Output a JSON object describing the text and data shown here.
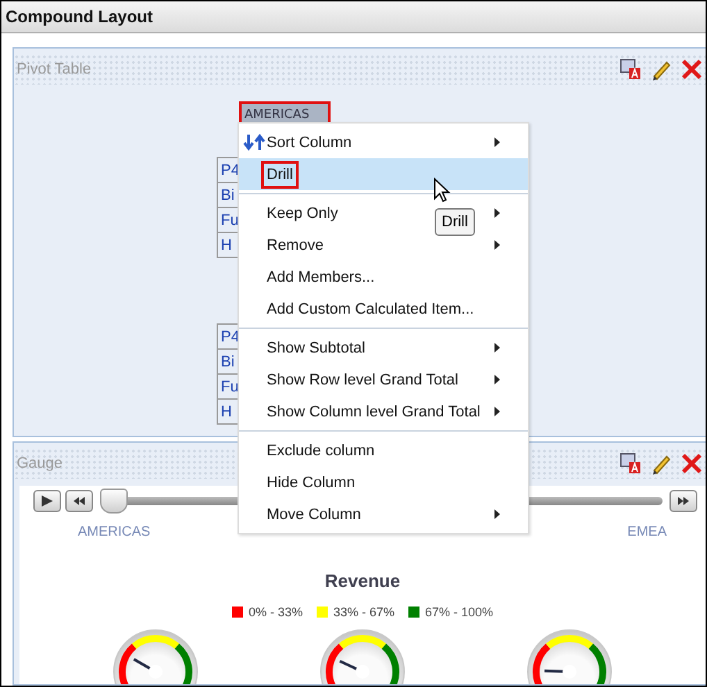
{
  "window": {
    "title": "Compound Layout"
  },
  "pivot_section": {
    "title": "Pivot Table",
    "column_header": {
      "label": "AMERICAS",
      "outlined": true
    },
    "row_groups": [
      [
        "P4",
        "Bi",
        "Fu",
        "H"
      ],
      [
        "P4",
        "Bi",
        "Fu",
        "H"
      ]
    ]
  },
  "context_menu": {
    "groups": [
      [
        {
          "label": "Sort Column",
          "kind": "sort",
          "submenu": true,
          "selected": false,
          "outlined": false
        },
        {
          "label": "Drill",
          "kind": "plain",
          "submenu": false,
          "selected": true,
          "outlined": true
        }
      ],
      [
        {
          "label": "Keep Only",
          "kind": "plain",
          "submenu": true,
          "selected": false,
          "outlined": false
        },
        {
          "label": "Remove",
          "kind": "plain",
          "submenu": true,
          "selected": false,
          "outlined": false
        },
        {
          "label": "Add Members...",
          "kind": "plain",
          "submenu": false,
          "selected": false,
          "outlined": false
        },
        {
          "label": "Add Custom Calculated Item...",
          "kind": "plain",
          "submenu": false,
          "selected": false,
          "outlined": false
        }
      ],
      [
        {
          "label": "Show Subtotal",
          "kind": "plain",
          "submenu": true,
          "selected": false,
          "outlined": false
        },
        {
          "label": "Show Row level Grand Total",
          "kind": "plain",
          "submenu": true,
          "selected": false,
          "outlined": false
        },
        {
          "label": "Show Column level Grand Total",
          "kind": "plain",
          "submenu": true,
          "selected": false,
          "outlined": false
        }
      ],
      [
        {
          "label": "Exclude column",
          "kind": "plain",
          "submenu": false,
          "selected": false,
          "outlined": false
        },
        {
          "label": "Hide Column",
          "kind": "plain",
          "submenu": false,
          "selected": false,
          "outlined": false
        },
        {
          "label": "Move Column",
          "kind": "plain",
          "submenu": true,
          "selected": false,
          "outlined": false
        }
      ]
    ]
  },
  "tooltip": "Drill",
  "gauge_section": {
    "title": "Gauge",
    "slider": {
      "level": 0,
      "start_label": "AMERICAS",
      "end_label": "EMEA"
    },
    "chart_title": "Revenue",
    "legend": [
      {
        "label": "0% - 33%",
        "color": "#ff0000"
      },
      {
        "label": "33% - 67%",
        "color": "#ffff00"
      },
      {
        "label": "67% - 100%",
        "color": "#008000"
      }
    ]
  }
}
